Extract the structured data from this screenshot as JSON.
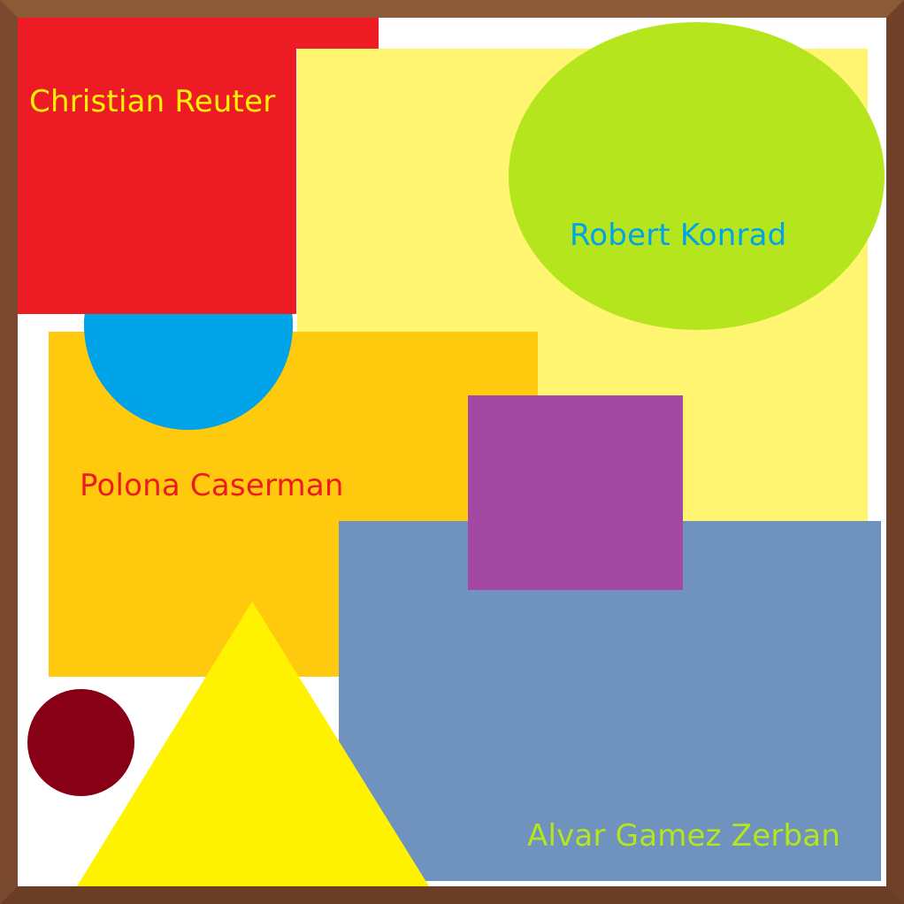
{
  "labels": {
    "christian": "Christian Reuter",
    "robert": "Robert Konrad",
    "polona": "Polona Caserman",
    "alvar": "Alvar Gamez Zerban"
  },
  "colors": {
    "frame": "#7b4a2e",
    "background": "#ffffff",
    "red_rect": "#ed1c24",
    "pale_yellow_rect": "#fff570",
    "green_ellipse": "#b5e61d",
    "blue_circle": "#00a2e8",
    "orange_rect": "#ffc90e",
    "purple_square": "#a349a4",
    "steel_blue_rect": "#7092be",
    "dark_red_circle": "#880015",
    "yellow_triangle": "#fff200",
    "text_christian": "#fff200",
    "text_robert": "#00a2e8",
    "text_polona": "#ed1c24",
    "text_alvar": "#b5e61d"
  }
}
